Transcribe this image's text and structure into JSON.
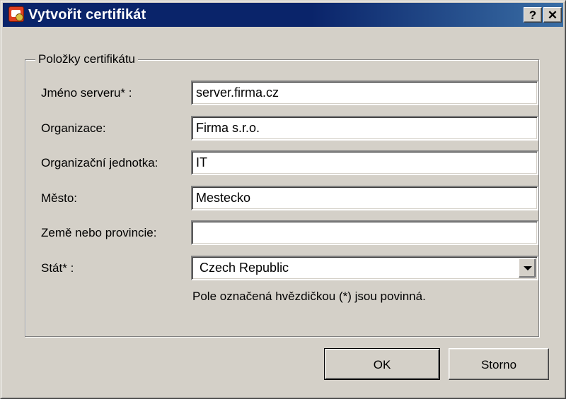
{
  "window": {
    "title": "Vytvořit certifikát",
    "help_button": "?",
    "close_button": "✕"
  },
  "group": {
    "legend": "Položky certifikátu"
  },
  "fields": {
    "server_name": {
      "label": "Jméno serveru* :",
      "value": "server.firma.cz"
    },
    "organization": {
      "label": "Organizace:",
      "value": "Firma s.r.o."
    },
    "org_unit": {
      "label": "Organizační jednotka:",
      "value": "IT"
    },
    "city": {
      "label": "Město:",
      "value": "Mestecko"
    },
    "region": {
      "label": "Země nebo provincie:",
      "value": ""
    },
    "country": {
      "label": "Stát* :",
      "value": "Czech Republic"
    }
  },
  "note": "Pole označená hvězdičkou (*) jsou povinná.",
  "buttons": {
    "ok": "OK",
    "cancel": "Storno"
  },
  "icons": {
    "title": "certificate-icon",
    "dropdown": "chevron-down-icon"
  }
}
